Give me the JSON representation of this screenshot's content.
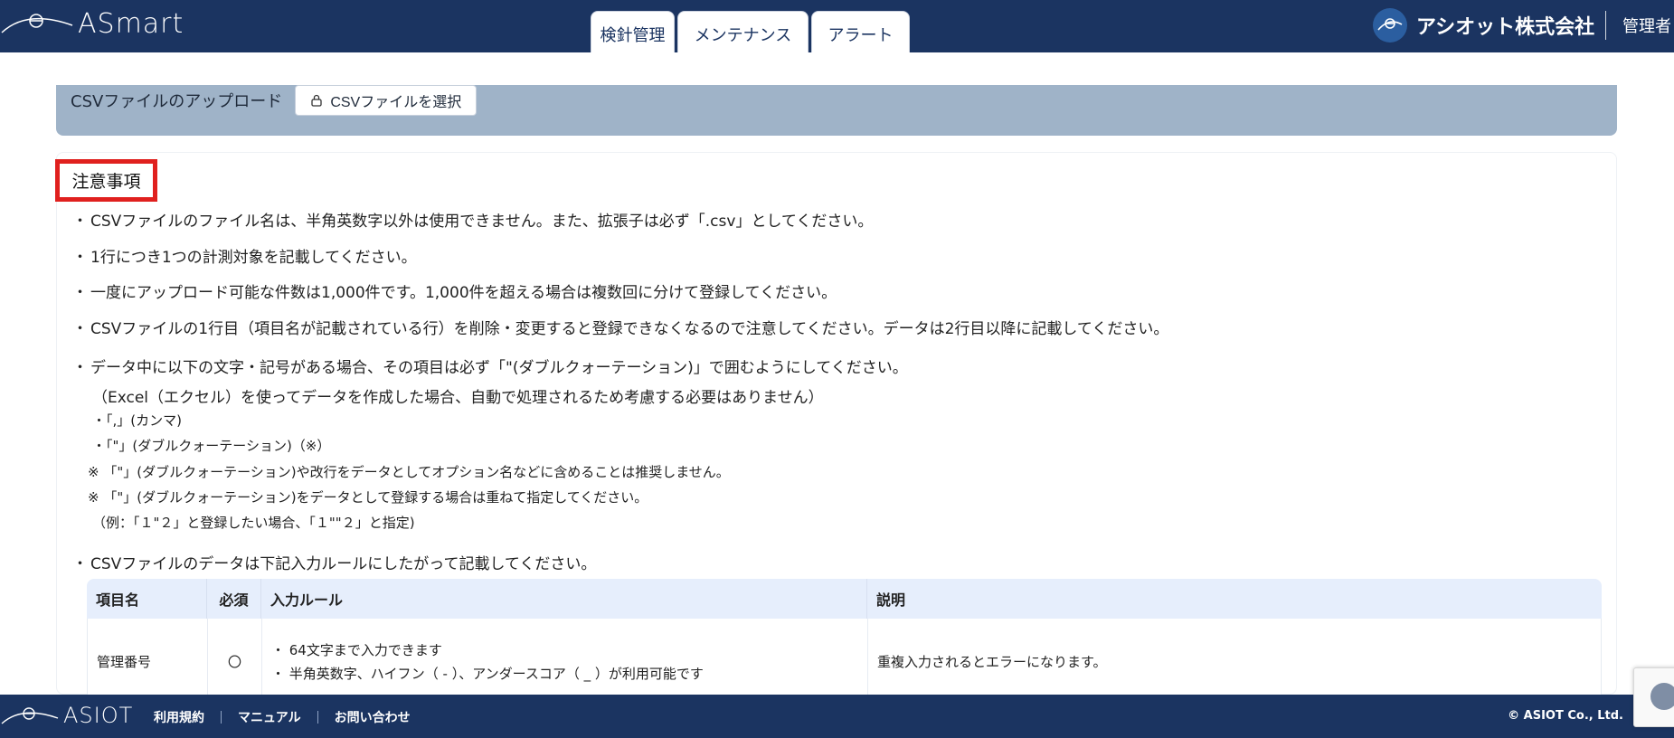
{
  "header": {
    "app_name": "ASmart",
    "tabs": [
      {
        "label": "検針管理",
        "active": false
      },
      {
        "label": "メンテナンス",
        "active": true
      },
      {
        "label": "アラート",
        "active": false
      }
    ],
    "company_name": "アシオット株式会社",
    "user_label": "管理者"
  },
  "upload": {
    "label": "CSVファイルのアップロード",
    "button_label": "CSVファイルを選択"
  },
  "notice": {
    "title": "注意事項",
    "bullet_mark": "・",
    "items": [
      "CSVファイルのファイル名は、半角英数字以外は使用できません。また、拡張子は必ず「.csv」としてください。",
      "1行につき1つの計測対象を記載してください。",
      "一度にアップロード可能な件数は1,000件です。1,000件を超える場合は複数回に分けて登録してください。",
      "CSVファイルの1行目（項目名が記載されている行）を削除・変更すると登録できなくなるので注意してください。データは2行目以降に記載してください。",
      "データ中に以下の文字・記号がある場合、その項目は必ず「\"(ダブルクォーテーション)」で囲むようにしてください。",
      "CSVファイルのデータは下記入力ルールにしたがって記載してください。"
    ],
    "sub_items": [
      "（Excel（エクセル）を使ってデータを作成した場合、自動で処理されるため考慮する必要はありません）",
      "・「,」(カンマ)",
      "・「\"」(ダブルクォーテーション)（※）",
      "※ 「\"」(ダブルクォーテーション)や改行をデータとしてオプション名などに含めることは推奨しません。",
      "※ 「\"」(ダブルクォーテーション)をデータとして登録する場合は重ねて指定してください。",
      "（例：「１\"２」と登録したい場合、「１\"\"２」と指定)"
    ]
  },
  "rule_table": {
    "headers": [
      "項目名",
      "必須",
      "入力ルール",
      "説明"
    ],
    "rows": [
      {
        "name": "管理番号",
        "required": "〇",
        "rules": [
          "・ 64文字まで入力できます",
          "・ 半角英数字、ハイフン（ - ）、アンダースコア（ _ ）が利用可能です"
        ],
        "description": "重複入力されるとエラーになります。"
      }
    ]
  },
  "footer": {
    "brand": "ASIOT",
    "links": [
      "利用規約",
      "マニュアル",
      "お問い合わせ"
    ],
    "copyright": "© ASIOT Co., Ltd."
  },
  "colors": {
    "header_bg": "#1b3461",
    "upload_bar_bg": "#9fb3c8",
    "highlight_border": "#e0201e",
    "table_head_bg": "#e6eefc"
  }
}
